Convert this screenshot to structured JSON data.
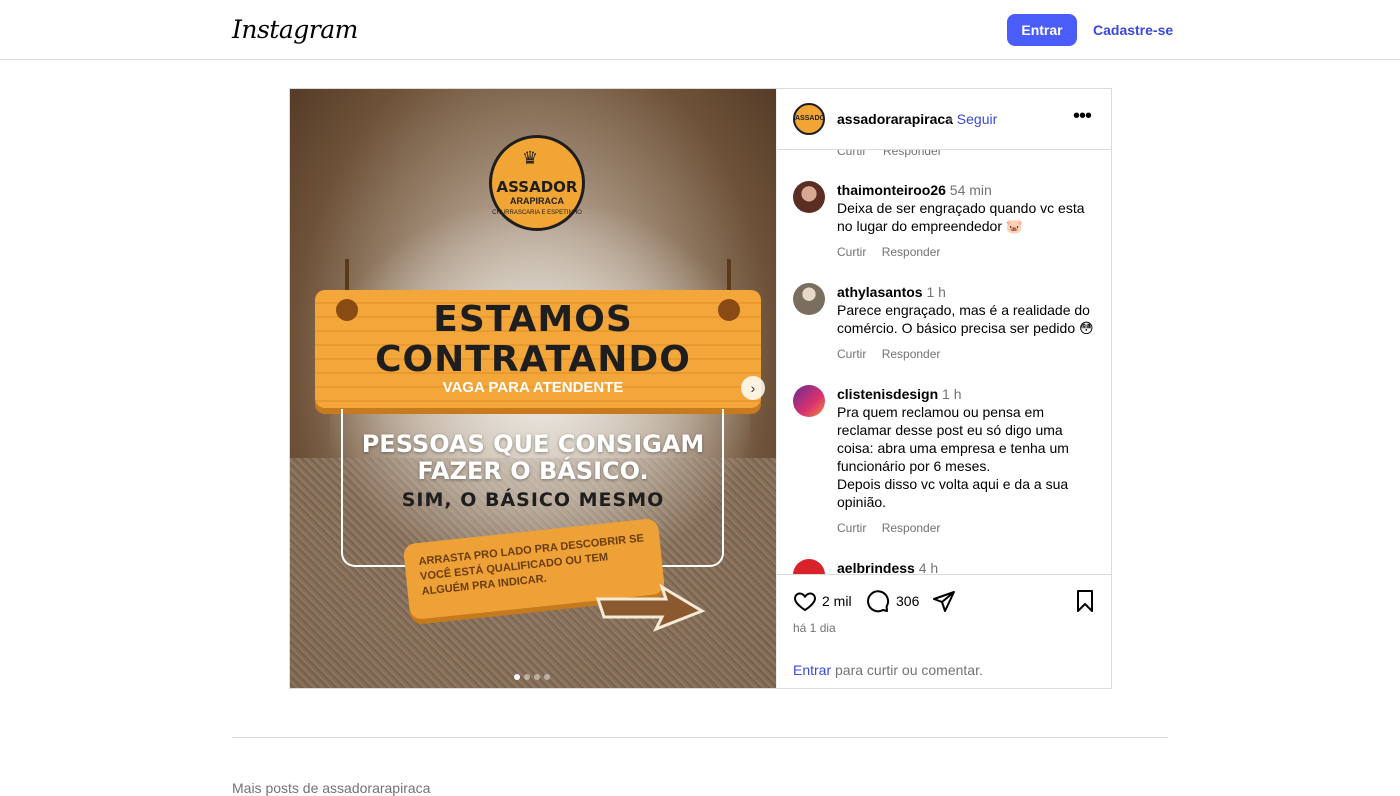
{
  "nav": {
    "logo": "Instagram",
    "login_label": "Entrar",
    "signup_label": "Cadastre-se"
  },
  "media": {
    "seal_name": "ASSADOR",
    "seal_city": "ARAPIRACA",
    "seal_tag": "CHURRASCARIA E ESPETINHO",
    "sign_line1": "ESTAMOS",
    "sign_line2": "CONTRATANDO",
    "sign_sub": "VAGA PARA ATENDENTE",
    "frame_line1": "PESSOAS QUE CONSIGAM",
    "frame_line2": "FAZER O BÁSICO.",
    "frame_line3": "SIM, O BÁSICO MESMO",
    "tag_text": "ARRASTA PRO LADO PRA DESCOBRIR SE VOCÊ ESTÁ QUALIFICADO OU TEM ALGUÉM PRA INDICAR.",
    "carousel_total": 4,
    "carousel_active": 1
  },
  "panel": {
    "username": "assadorarapiraca",
    "separator": "•",
    "follow_label": "Seguir",
    "more_label": "•••",
    "stub_like": "Curtir",
    "stub_reply": "Responder",
    "comments": [
      {
        "user": "thaimonteiroo26",
        "time": "54 min",
        "text": "Deixa de ser engraçado quando vc esta no lugar do empreendedor 🐷",
        "like": "Curtir",
        "reply": "Responder"
      },
      {
        "user": "athylasantos",
        "time": "1 h",
        "text": "Parece engraçado, mas é a realidade do comércio. O básico precisa ser pedido 😳",
        "like": "Curtir",
        "reply": "Responder"
      },
      {
        "user": "clistenisdesign",
        "time": "1 h",
        "text": "Pra quem reclamou ou pensa em reclamar desse post eu só digo uma coisa: abra uma empresa e tenha um funcionário por 6 meses.\nDepois disso vc volta aqui e da a sua opinião.",
        "like": "Curtir",
        "reply": "Responder"
      },
      {
        "user": "aelbrindess",
        "time": "4 h",
        "text": "",
        "like": "",
        "reply": ""
      }
    ],
    "likes_count": "2 mil",
    "comments_count": "306",
    "post_date": "há 1 dia",
    "login_link": "Entrar",
    "login_suffix": " para curtir ou comentar."
  },
  "footer": {
    "more_posts": "Mais posts de assadorarapiraca"
  },
  "colors": {
    "accent": "#4a5df9",
    "link": "#3949d8",
    "muted": "#737373",
    "brand_orange": "#f0a534"
  }
}
